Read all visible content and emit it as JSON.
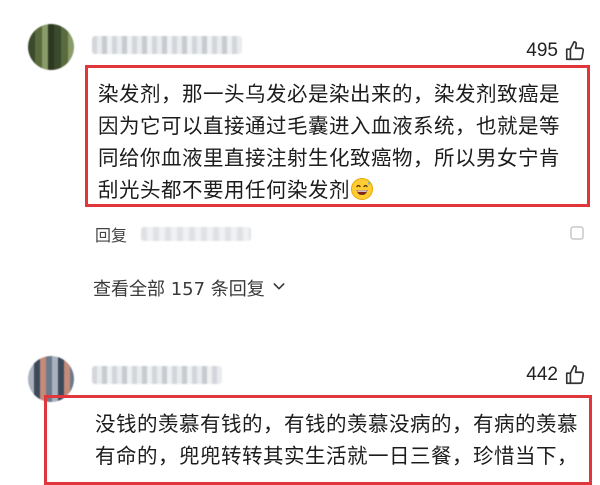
{
  "comments": [
    {
      "likes": "495",
      "text": "染发剂，那一头乌发必是染出来的，染发剂致癌是因为它可以直接通过毛囊进入血液系统，也就是等同给你血液里直接注射生化致癌物，所以男女宁肯刮光头都不要用任何染发剂",
      "emoji": "grinning-sweat-emoji",
      "reply_label": "回复",
      "view_replies": "查看全部 157 条回复"
    },
    {
      "likes": "442",
      "text": "没钱的羡慕有钱的，有钱的羡慕没病的，有病的羡慕有命的，兜兜转转其实生活就一日三餐，珍惜当下，"
    }
  ],
  "colors": {
    "highlight_border": "#e0373d",
    "text": "#1c1c1c",
    "muted": "#444444"
  }
}
